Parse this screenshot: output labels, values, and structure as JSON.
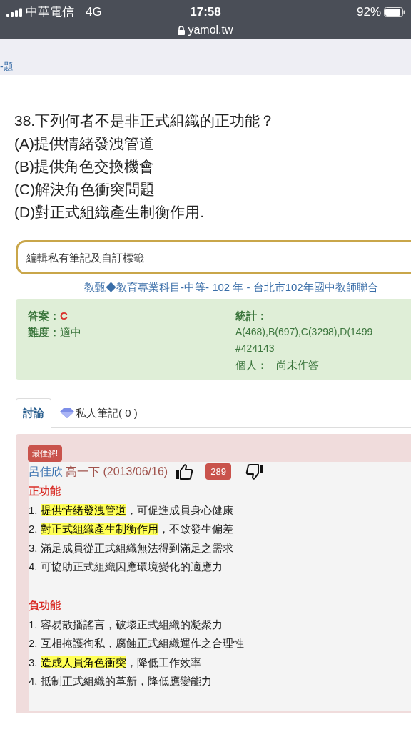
{
  "status_bar": {
    "carrier": "中華電信",
    "network": "4G",
    "time": "17:58",
    "battery": "92%",
    "url": "yamol.tw"
  },
  "nav": {
    "link": "-題"
  },
  "question": {
    "title": "38.下列何者不是非正式組織的正功能？",
    "options": [
      "(A)提供情緒發洩管道",
      "(B)提供角色交換機會",
      "(C)解決角色衝突問題",
      "(D)對正式組織產生制衡作用."
    ]
  },
  "notes_field": {
    "placeholder": "編輯私有筆記及自訂標籤"
  },
  "source": "教甄◆教育專業科目-中等- 102 年 - 台北市102年國中教師聯合",
  "info": {
    "answer_label": "答案：",
    "answer": "C",
    "difficulty_label": "難度：",
    "difficulty": "適中",
    "stats_label": "統計：",
    "stats": "A(468),B(697),C(3298),D(1499",
    "id": "#424143",
    "personal_label": "個人：",
    "personal": "尚未作答"
  },
  "tabs": [
    {
      "label": "討論",
      "selected": true
    },
    {
      "label": "私人筆記( 0 )",
      "selected": false
    }
  ],
  "discussion": {
    "badge": "最佳解!",
    "author": "呂佳欣",
    "grade": "高一下 (2013/06/16)",
    "likes": "289",
    "sections": [
      {
        "heading": "正功能",
        "items": [
          {
            "number": "1.",
            "highlight": "提供情緒發洩管道",
            "text": "，可促進成員身心健康"
          },
          {
            "number": "2.",
            "highlight": "對正式組織產生制衡作用",
            "text": "，不致發生偏差"
          },
          {
            "number": "3.",
            "text": "滿足成員從正式組織無法得到滿足之需求"
          },
          {
            "number": "4.",
            "text": "可協助正式組織因應環境變化的適應力"
          }
        ]
      },
      {
        "heading": "負功能",
        "items": [
          {
            "number": "1.",
            "text": "容易散播謠言，破壞正式組織的凝聚力"
          },
          {
            "number": "2.",
            "text": "互相掩護徇私，腐蝕正式組織運作之合理性"
          },
          {
            "number": "3.",
            "highlight": "造成人員角色衝突",
            "text": "，降低工作效率"
          },
          {
            "number": "4.",
            "text": "抵制正式組織的革新，降低應變能力"
          }
        ]
      }
    ]
  }
}
